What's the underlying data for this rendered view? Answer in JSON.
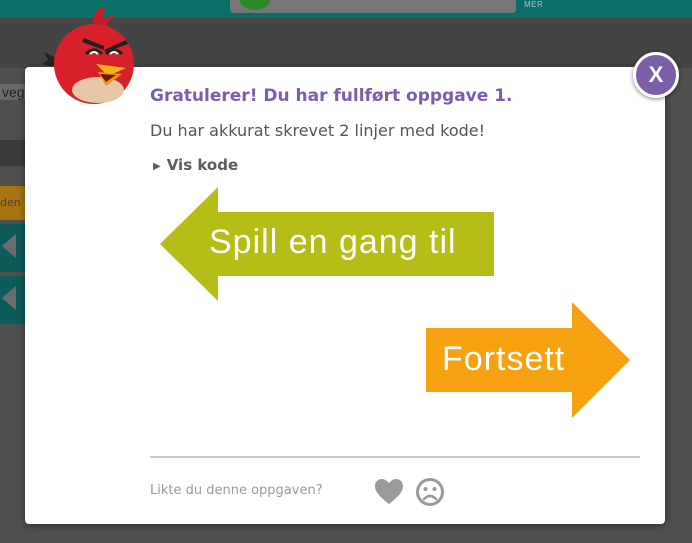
{
  "background": {
    "top_label": "MER",
    "left_text": "veg",
    "orange_text": "den"
  },
  "modal": {
    "close_label": "X",
    "title": "Gratulerer! Du har fullført oppgave 1.",
    "subtitle": "Du har akkurat skrevet 2 linjer med kode!",
    "show_code_label": "Vis kode",
    "play_again_label": "Spill en gang til",
    "continue_label": "Fortsett",
    "feedback_prompt": "Likte du denne oppgaven?"
  },
  "colors": {
    "accent": "#7b5ea7",
    "play_again": "#b7bd17",
    "continue": "#f6a10f",
    "bird": "#d8202a"
  },
  "icons": {
    "show_code": "triangle-right-icon",
    "like": "heart-icon",
    "dislike": "frown-face-icon",
    "mascot": "red-angry-bird"
  }
}
